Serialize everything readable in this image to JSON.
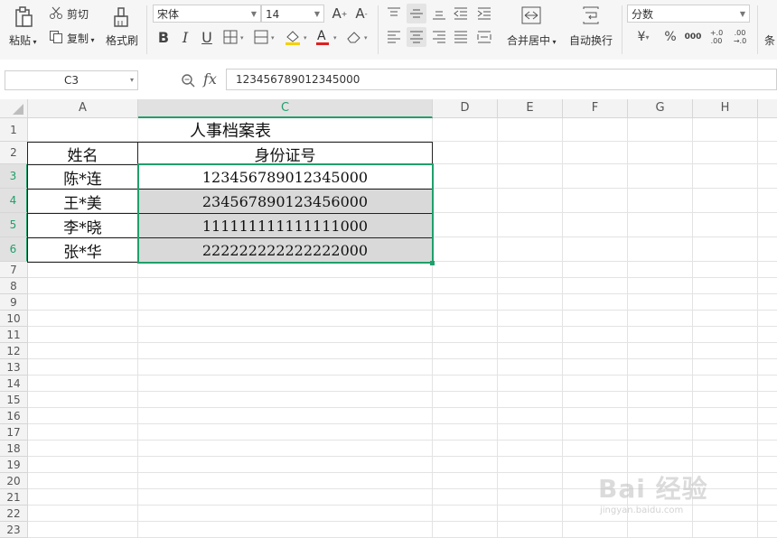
{
  "ribbon": {
    "paste_label": "粘贴",
    "cut_label": "剪切",
    "copy_label": "复制",
    "format_painter_label": "格式刷",
    "font_name": "宋体",
    "font_size": "14",
    "bold": "B",
    "italic": "I",
    "underline": "U",
    "font_color_letter": "A",
    "merge_center_label": "合并居中",
    "wrap_label": "自动换行",
    "number_format": "分数",
    "currency_symbol": "¥",
    "percent_symbol": "%",
    "thousands_symbol": "000",
    "increase_decimal": "+.0 .00",
    "decrease_decimal": ".00 →.0",
    "conditional_label": "条",
    "accent_color": "#1f9f6a"
  },
  "formula_bar": {
    "cell_ref": "C3",
    "fx_label": "fx",
    "content": "123456789012345000"
  },
  "sheet": {
    "columns": [
      "A",
      "C",
      "D",
      "E",
      "F",
      "G",
      "H"
    ],
    "selected_column": "C",
    "rows": [
      "1",
      "2",
      "3",
      "4",
      "5",
      "6",
      "7",
      "8",
      "9",
      "10",
      "11",
      "12",
      "13",
      "14",
      "15",
      "16",
      "17",
      "18",
      "19",
      "20",
      "21",
      "22",
      "23"
    ],
    "selected_rows": [
      "3",
      "4",
      "5",
      "6"
    ],
    "title": "人事档案表",
    "header_name": "姓名",
    "header_id": "身份证号",
    "records": [
      {
        "name": "陈*连",
        "id": "123456789012345000"
      },
      {
        "name": "王*美",
        "id": "234567890123456000"
      },
      {
        "name": "李*晓",
        "id": "111111111111111000"
      },
      {
        "name": "张*华",
        "id": "222222222222222000"
      }
    ]
  },
  "watermark": {
    "brand": "Bai 经验",
    "url": "jingyan.baidu.com"
  }
}
